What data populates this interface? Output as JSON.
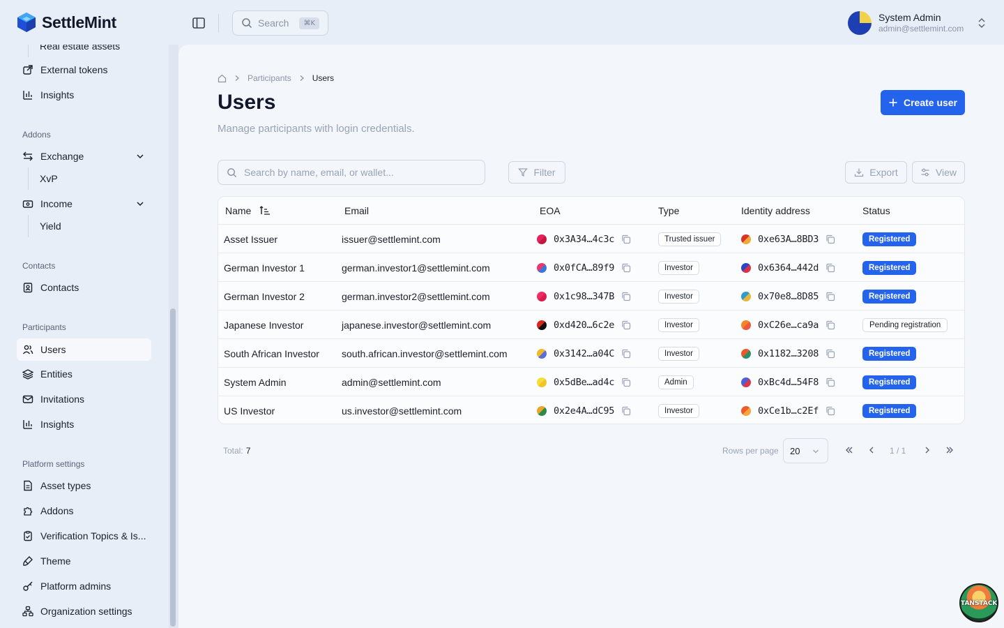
{
  "brand": {
    "name": "SettleMint"
  },
  "topbar": {
    "search_label": "Search",
    "search_shortcut": "⌘K",
    "user_name": "System Admin",
    "user_email": "admin@settlemint.com"
  },
  "sidebar": {
    "partial_item": "Real estate assets",
    "items_top": [
      {
        "label": "External tokens",
        "icon": "external-link-icon"
      },
      {
        "label": "Insights",
        "icon": "bar-chart-icon"
      }
    ],
    "addons_heading": "Addons",
    "exchange_label": "Exchange",
    "exchange_sub": "XvP",
    "income_label": "Income",
    "income_sub": "Yield",
    "contacts_heading": "Contacts",
    "contacts_label": "Contacts",
    "participants_heading": "Participants",
    "participants_items": [
      {
        "label": "Users",
        "icon": "users-icon",
        "active": true
      },
      {
        "label": "Entities",
        "icon": "layers-icon"
      },
      {
        "label": "Invitations",
        "icon": "mail-icon"
      },
      {
        "label": "Insights",
        "icon": "bar-chart-icon"
      }
    ],
    "platform_heading": "Platform settings",
    "platform_items": [
      {
        "label": "Asset types",
        "icon": "file-icon"
      },
      {
        "label": "Addons",
        "icon": "puzzle-icon"
      },
      {
        "label": "Verification Topics & Is...",
        "icon": "clipboard-check-icon"
      },
      {
        "label": "Theme",
        "icon": "brush-icon"
      },
      {
        "label": "Platform admins",
        "icon": "key-icon"
      },
      {
        "label": "Organization settings",
        "icon": "org-icon"
      }
    ]
  },
  "breadcrumb": {
    "level1": "Participants",
    "current": "Users"
  },
  "page": {
    "title": "Users",
    "subtitle": "Manage participants with login credentials.",
    "create_button": "Create user"
  },
  "toolbar": {
    "search_placeholder": "Search by name, email, or wallet...",
    "filter_label": "Filter",
    "export_label": "Export",
    "view_label": "View"
  },
  "table": {
    "headers": {
      "name": "Name",
      "email": "Email",
      "eoa": "EOA",
      "type": "Type",
      "identity": "Identity address",
      "status": "Status"
    },
    "rows": [
      {
        "name": "Asset Issuer",
        "email": "issuer@settlemint.com",
        "eoa": "0x3A34…4c3c",
        "type": "Trusted issuer",
        "identity": "0xe63A…8BD3",
        "status": "Registered",
        "eoa_colors": [
          "#e2245a",
          "#c4173f"
        ],
        "id_colors": [
          "#d9342b",
          "#f2a83a"
        ]
      },
      {
        "name": "German Investor 1",
        "email": "german.investor1@settlemint.com",
        "eoa": "0x0fCA…89f9",
        "type": "Investor",
        "identity": "0x6364…442d",
        "status": "Registered",
        "eoa_colors": [
          "#e33a73",
          "#3b77d6"
        ],
        "id_colors": [
          "#2a46c4",
          "#d9304b"
        ]
      },
      {
        "name": "German Investor 2",
        "email": "german.investor2@settlemint.com",
        "eoa": "0x1c98…347B",
        "type": "Investor",
        "identity": "0x70e8…8D85",
        "status": "Registered",
        "eoa_colors": [
          "#ef2d64",
          "#d71e4e"
        ],
        "id_colors": [
          "#2e9bd0",
          "#e3b63e"
        ]
      },
      {
        "name": "Japanese Investor",
        "email": "japanese.investor@settlemint.com",
        "eoa": "0xd420…6c2e",
        "type": "Investor",
        "identity": "0xC26e…ca9a",
        "status": "Pending registration",
        "eoa_colors": [
          "#d6261e",
          "#111111"
        ],
        "id_colors": [
          "#f2842b",
          "#ea5a3b"
        ]
      },
      {
        "name": "South African Investor",
        "email": "south.african.investor@settlemint.com",
        "eoa": "0x3142…a04C",
        "type": "Investor",
        "identity": "0x1182…3208",
        "status": "Registered",
        "eoa_colors": [
          "#f0b82b",
          "#5a6fd8"
        ],
        "id_colors": [
          "#e85a2a",
          "#2b8f6a"
        ]
      },
      {
        "name": "System Admin",
        "email": "admin@settlemint.com",
        "eoa": "0x5dBe…ad4c",
        "type": "Admin",
        "identity": "0xBc4d…54F8",
        "status": "Registered",
        "eoa_colors": [
          "#f5dd3a",
          "#f0c52a"
        ],
        "id_colors": [
          "#4c5fd8",
          "#d8364a"
        ]
      },
      {
        "name": "US Investor",
        "email": "us.investor@settlemint.com",
        "eoa": "0x2e4A…dC95",
        "type": "Investor",
        "identity": "0xCe1b…c2Ef",
        "status": "Registered",
        "eoa_colors": [
          "#e9a62a",
          "#2f8a4a"
        ],
        "id_colors": [
          "#ee5a2c",
          "#f3a63c"
        ]
      }
    ]
  },
  "footer": {
    "total_label": "Total:",
    "total_value": "7",
    "rows_per_page_label": "Rows per page",
    "rows_per_page_value": "20",
    "page_indicator": "1 / 1"
  },
  "badge": {
    "label": "TANSTACK"
  },
  "colors": {
    "accent": "#2463eb",
    "background": "#e8eef8",
    "panel": "#f3f6fb"
  }
}
